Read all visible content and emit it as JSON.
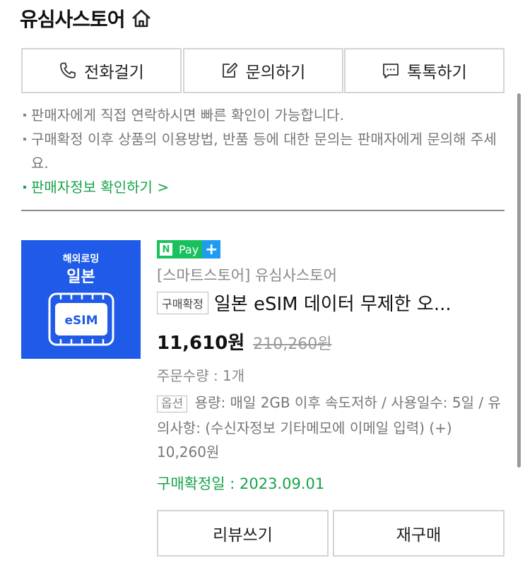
{
  "store": {
    "name": "유심사스토어"
  },
  "contact": {
    "call_label": "전화걸기",
    "inquiry_label": "문의하기",
    "talk_label": "톡톡하기"
  },
  "notices": [
    "판매자에게 직접 연락하시면 빠른 확인이 가능합니다.",
    "구매확정 이후 상품의 이용방법, 반품 등에 대한 문의는 판매자에게 문의해 주세요."
  ],
  "seller_info_link": "판매자정보 확인하기 >",
  "product": {
    "thumb_line1": "해외로밍",
    "thumb_line2": "일본",
    "thumb_esim": "eSIM",
    "npay_n": "N",
    "npay_pay": "Pay",
    "npay_plus": "+",
    "store_line": "[스마트스토어] 유심사스토어",
    "badge": "구매확정",
    "title": "일본 eSIM 데이터 무제한 오...",
    "price": "11,610원",
    "original_price": "210,260원",
    "quantity": "주문수량 : 1개",
    "option_badge": "옵션",
    "option_text": "용량: 매일 2GB 이후 속도저하 / 사용일수: 5일 / 유의사항: (수신자정보 기타메모에 이메일 입력) (+) 10,260원",
    "confirm_date": "구매확정일 : 2023.09.01"
  },
  "actions": {
    "review_label": "리뷰쓰기",
    "rebuy_label": "재구매"
  },
  "colors": {
    "accent_green": "#16a34a",
    "npay_green": "#19c15d",
    "npay_blue": "#1e9df0",
    "thumb_blue": "#1f5be8"
  }
}
